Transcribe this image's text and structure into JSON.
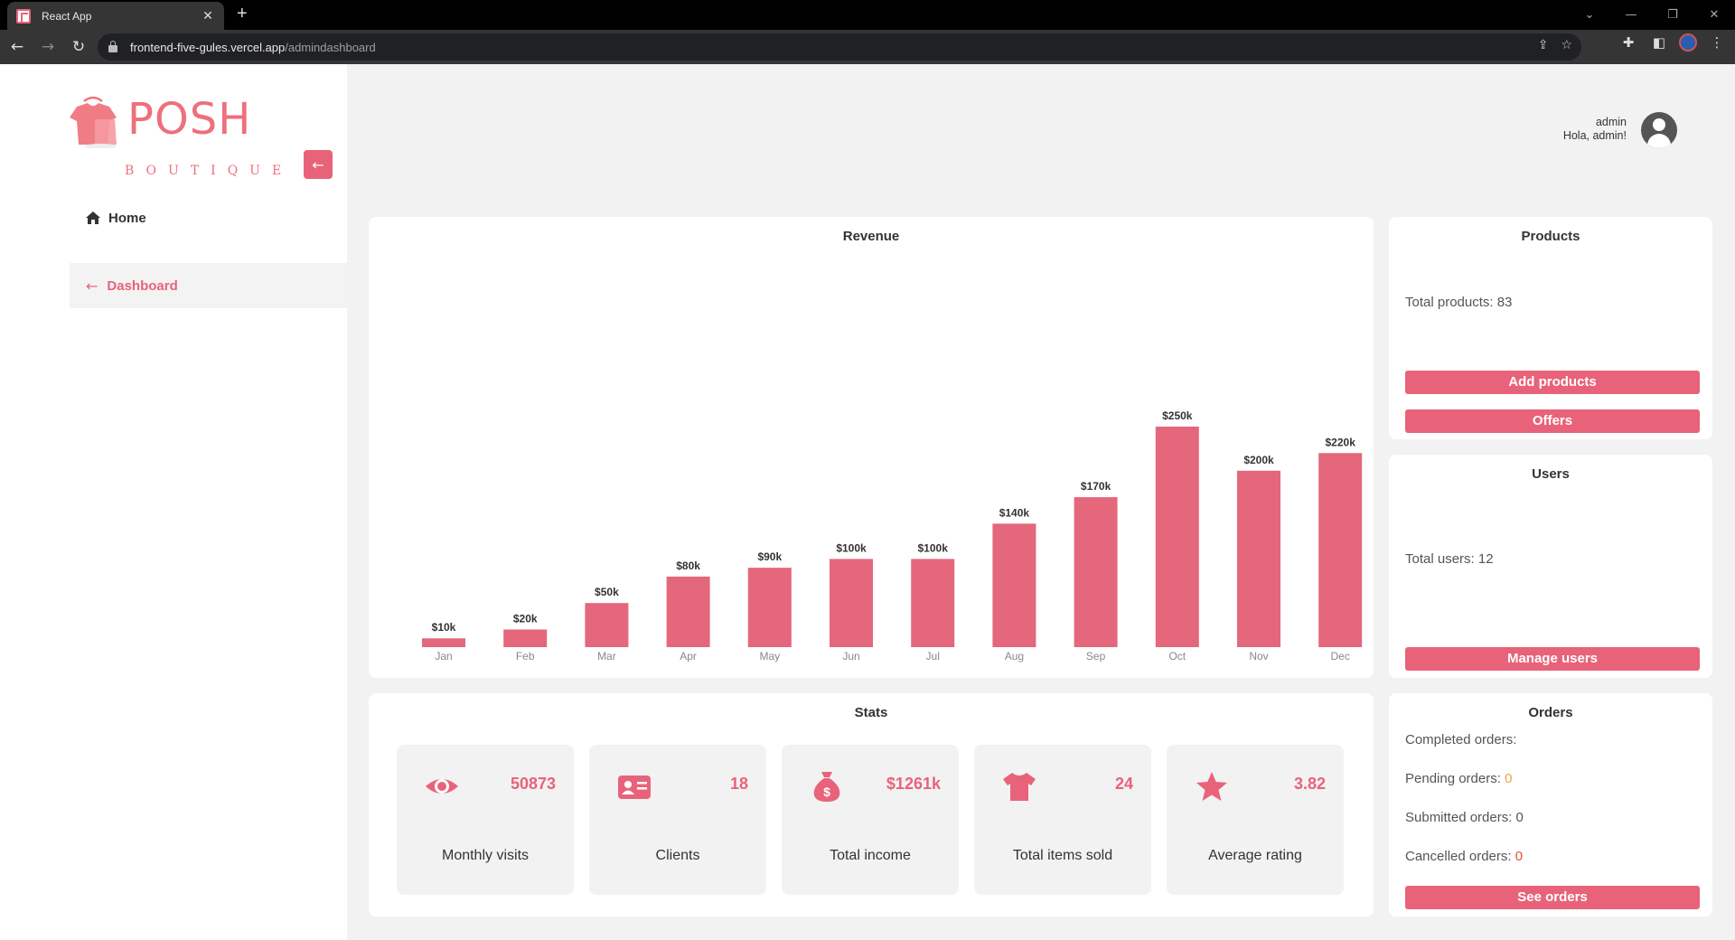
{
  "browser": {
    "tab_title": "React App",
    "tab_close": "✕",
    "new_tab": "+",
    "url_host": "frontend-five-gules.vercel.app",
    "url_path": "/admindashboard"
  },
  "sidebar": {
    "logo_word": "POSH",
    "logo_sub": "BOUTIQUE",
    "collapse_icon": "←",
    "home_label": "Home",
    "dashboard_label": "Dashboard",
    "accent_color": "#e8637a"
  },
  "header": {
    "username": "admin",
    "greeting": "Hola, admin!"
  },
  "revenue": {
    "title": "Revenue"
  },
  "chart_data": {
    "type": "bar",
    "title": "Revenue",
    "categories": [
      "Jan",
      "Feb",
      "Mar",
      "Apr",
      "May",
      "Jun",
      "Jul",
      "Aug",
      "Sep",
      "Oct",
      "Nov",
      "Dec"
    ],
    "values": [
      10,
      20,
      50,
      80,
      90,
      100,
      100,
      140,
      170,
      250,
      200,
      220
    ],
    "value_labels": [
      "$10k",
      "$20k",
      "$50k",
      "$80k",
      "$90k",
      "$100k",
      "$100k",
      "$140k",
      "$170k",
      "$250k",
      "$200k",
      "$220k"
    ],
    "ylim": [
      0,
      250
    ],
    "grid": false,
    "color": "#e4677c"
  },
  "products": {
    "title": "Products",
    "total_text": "Total products: 83",
    "add_button": "Add products",
    "offers_button": "Offers"
  },
  "users": {
    "title": "Users",
    "total_text": "Total users: 12",
    "manage_button": "Manage users"
  },
  "stats": {
    "title": "Stats",
    "tiles": [
      {
        "icon": "eye-icon",
        "value": "50873",
        "label": "Monthly visits"
      },
      {
        "icon": "id-card-icon",
        "value": "18",
        "label": "Clients"
      },
      {
        "icon": "money-bag-icon",
        "value": "$1261k",
        "label": "Total income"
      },
      {
        "icon": "shirt-icon",
        "value": "24",
        "label": "Total items sold"
      },
      {
        "icon": "star-icon",
        "value": "3.82",
        "label": "Average rating"
      }
    ]
  },
  "orders": {
    "title": "Orders",
    "completed_label": "Completed orders:",
    "pending_label": "Pending orders: ",
    "pending_value": "0",
    "submitted_label": "Submitted orders: 0",
    "cancelled_label": "Cancelled orders: ",
    "cancelled_value": "0",
    "see_button": "See orders"
  }
}
